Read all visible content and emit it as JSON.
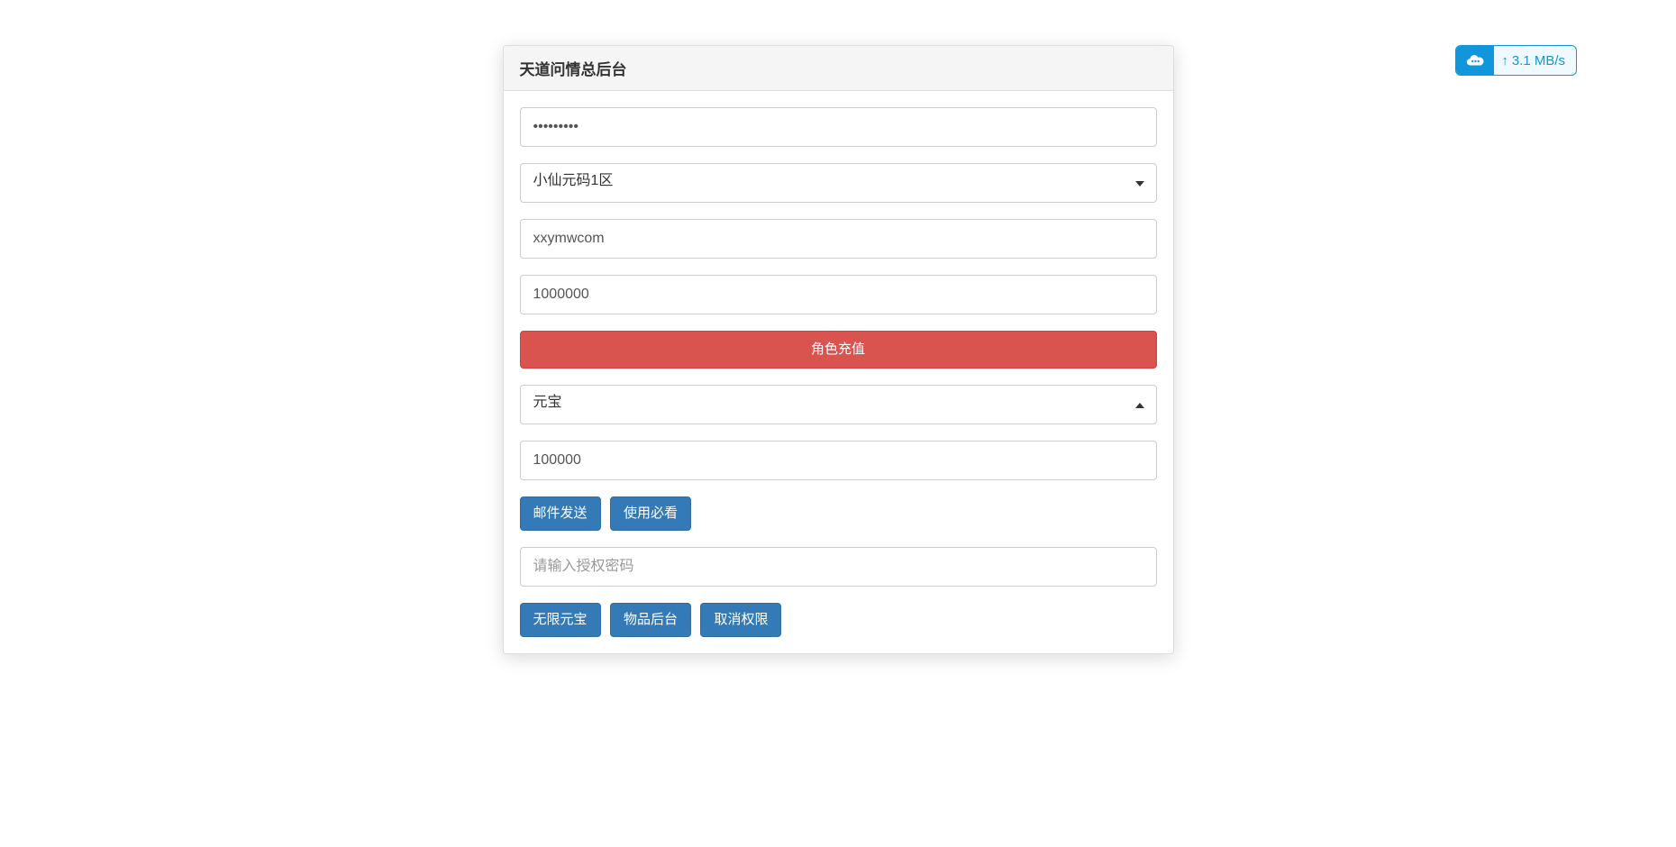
{
  "panel": {
    "title": "天道问情总后台"
  },
  "form": {
    "password_value": "•••••••••",
    "server_select": "小仙元码1区",
    "account_value": "xxymwcom",
    "amount1_value": "1000000",
    "recharge_button": "角色充值",
    "currency_select": "元宝",
    "amount2_value": "100000",
    "mail_send_button": "邮件发送",
    "usage_button": "使用必看",
    "auth_placeholder": "请输入授权密码",
    "unlimited_button": "无限元宝",
    "item_admin_button": "物品后台",
    "revoke_button": "取消权限"
  },
  "widget": {
    "speed": "3.1 MB/s"
  }
}
